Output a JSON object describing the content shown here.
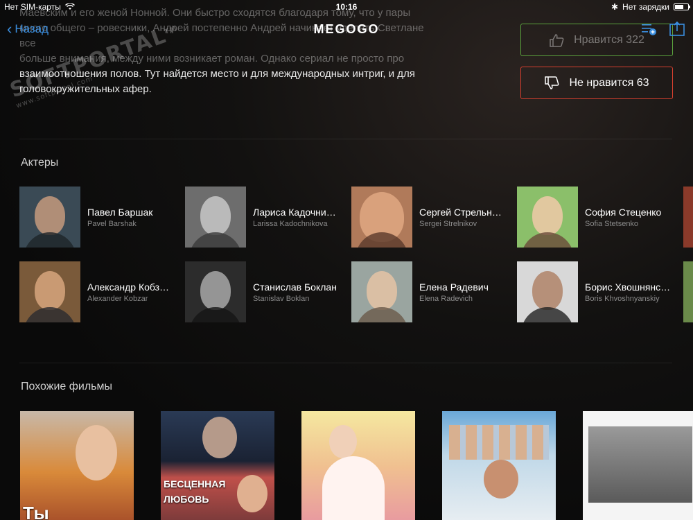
{
  "status": {
    "carrier": "Нет SIM-карты",
    "time": "10:16",
    "charging": "Нет зарядки"
  },
  "nav": {
    "back_label": "Назад",
    "brand": "MEGOGO",
    "icons": [
      "playlist-add-icon",
      "share-icon"
    ]
  },
  "description": {
    "faded_line1": "Маевским и его женой Нонной. Они быстро сходятся благодаря тому, что у пары",
    "faded_line2": "много общего – ровесники, Андрей постепенно Андрей начинает уделять Светлане все",
    "faded_line3": "больше внимания, между ними возникает роман. Однако сериал не просто про",
    "line4": "взаимоотношения полов. Тут найдется место и для международных интриг, и для",
    "line5": "головокружительных афер."
  },
  "rating": {
    "like_label": "Нравится 322",
    "dislike_label": "Не нравится 63",
    "like_color": "#5ba33d",
    "dislike_color": "#d9402f"
  },
  "watermark": {
    "text": "SOFTPORTAL",
    "tm": "TM",
    "url": "www.softportal.com"
  },
  "actors_section": {
    "title": "Актеры",
    "actors": [
      {
        "name": "Павел Баршак",
        "latin": "Pavel Barshak"
      },
      {
        "name": "Лариса Кадочникова",
        "latin": "Larissa Kadochnikova"
      },
      {
        "name": "Сергей Стрельников",
        "latin": "Sergei Strelnikov"
      },
      {
        "name": "София Стеценко",
        "latin": "Sofia Stetsenko"
      },
      {
        "name": "Александр Кобзарь",
        "latin": "Alexander Kobzar"
      },
      {
        "name": "Станислав Боклан",
        "latin": "Stanislav Boklan"
      },
      {
        "name": "Елена Радевич",
        "latin": "Elena Radevich"
      },
      {
        "name": "Борис Хвошнянский",
        "latin": "Boris Khvoshnyanskiy"
      }
    ]
  },
  "similar_section": {
    "title": "Похожие фильмы",
    "posters": [
      {
        "label": "Ты"
      },
      {
        "label": "БЕСЦЕННАЯ ЛЮБОВЬ"
      },
      {
        "label": ""
      },
      {
        "label": ""
      },
      {
        "label": ""
      }
    ]
  }
}
